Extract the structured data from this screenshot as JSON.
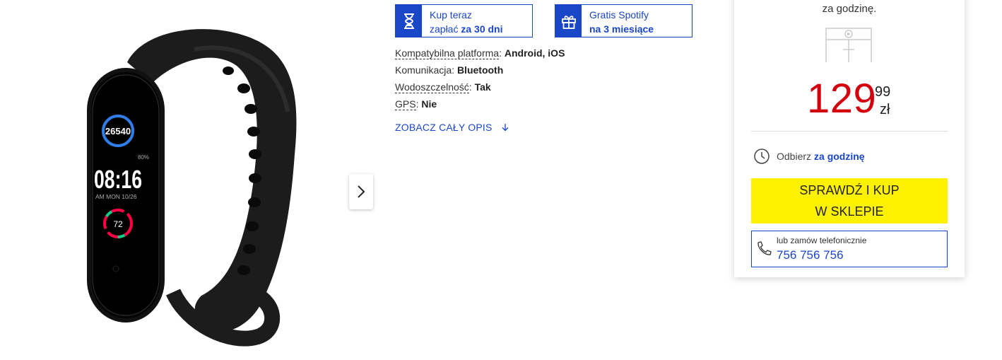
{
  "promos": {
    "pay_later": {
      "line1": "Kup teraz",
      "line2_prefix": "zapłać",
      "line2_bold": "za 30 dni",
      "icon": "hourglass-icon"
    },
    "spotify": {
      "line1": "Gratis Spotify",
      "line2_bold": "na 3 miesiące",
      "icon": "gift-icon"
    }
  },
  "specs": [
    {
      "label": "Kompatybilna platforma",
      "value": "Android, iOS"
    },
    {
      "label": "Komunikacja",
      "value": "Bluetooth"
    },
    {
      "label": "Wodoszczelność",
      "value": "Tak"
    },
    {
      "label": "GPS",
      "value": "Nie"
    }
  ],
  "see_description": {
    "label": "ZOBACZ CAŁY OPIS",
    "icon": "arrow-down-icon"
  },
  "watch_screen": {
    "steps": "26540",
    "time": "08:16",
    "day": "AM MON 10/26",
    "battery": "80%",
    "heart_rate": "72"
  },
  "panel": {
    "top_text": "za godzinę.",
    "price_int": "129",
    "price_cents": "99",
    "currency": "zł",
    "pickup_prefix": "Odbierz",
    "pickup_bold": "za godzinę",
    "buy_line1": "SPRAWDŹ I KUP",
    "buy_line2": "W SKLEPIE",
    "phone_label": "lub zamów telefonicznie",
    "phone_number": "756 756 756"
  },
  "colors": {
    "accent_blue": "#1a46c8",
    "price_red": "#d3000e",
    "buy_yellow": "#fff200"
  }
}
